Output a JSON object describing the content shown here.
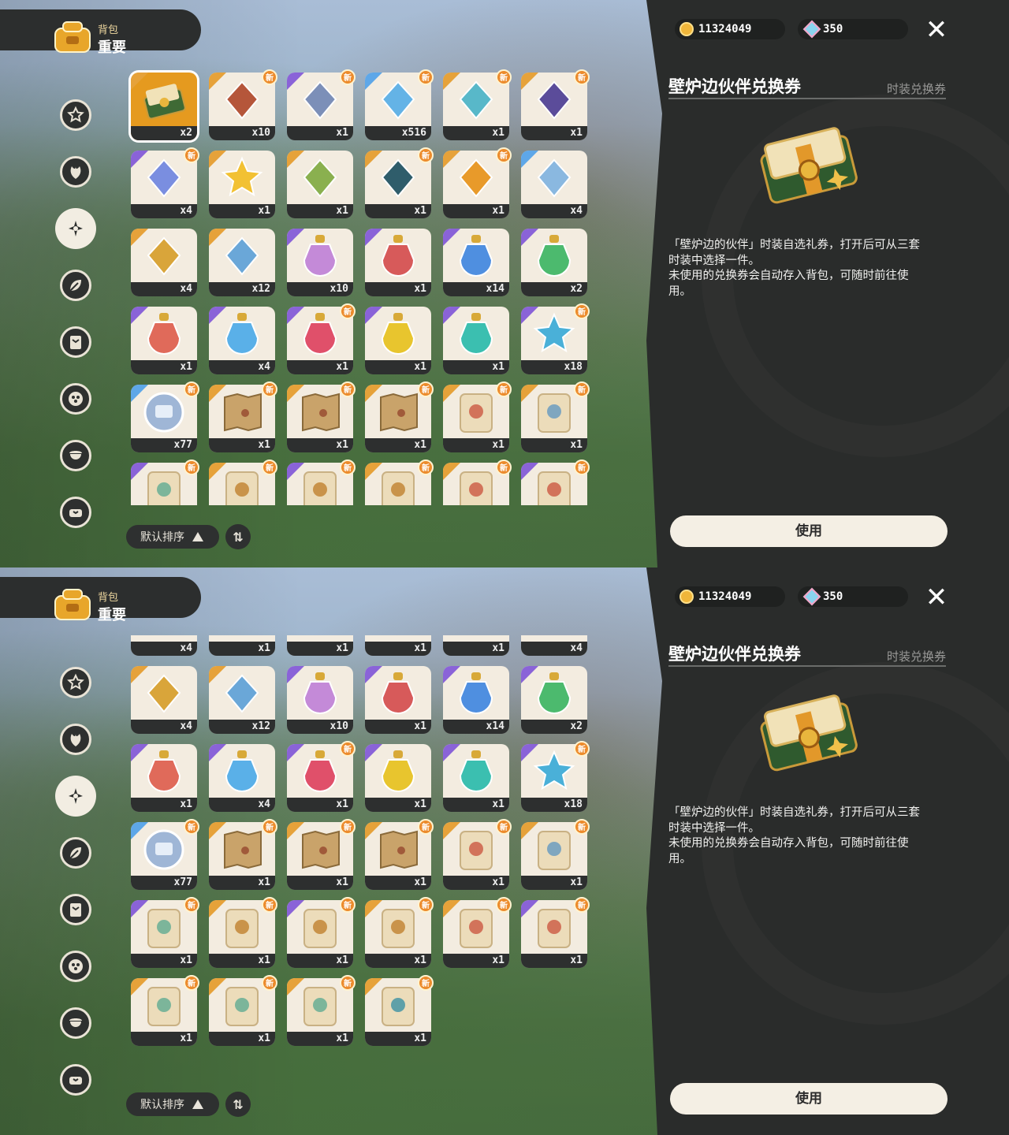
{
  "header": {
    "subtitle": "背包",
    "title": "重要"
  },
  "currency": {
    "coins": "11324049",
    "gems": "350"
  },
  "detail": {
    "name": "壁炉边伙伴兑换券",
    "type": "时装兑换券",
    "description": "「壁炉边的伙伴」时装自选礼券，打开后可从三套\n时装中选择一件。\n未使用的兑换券会自动存入背包，可随时前往使\n用。",
    "use_label": "使用"
  },
  "sort": {
    "label": "默认排序",
    "toggle_symbol": "⇅"
  },
  "new_badge": "新",
  "items": [
    {
      "icon": "coupon-icon",
      "qty": "x2",
      "rarity": "orange",
      "new": false,
      "color": "#3f6a35",
      "selected": true
    },
    {
      "icon": "photo-card-icon",
      "qty": "x10",
      "rarity": "orange",
      "new": true,
      "color": "#b5563a"
    },
    {
      "icon": "ticket-icon",
      "qty": "x1",
      "rarity": "purple",
      "new": true,
      "color": "#7c8fb8"
    },
    {
      "icon": "prism-icon",
      "qty": "x516",
      "rarity": "blue",
      "new": true,
      "color": "#64b3e6"
    },
    {
      "icon": "bottle-icon",
      "qty": "x1",
      "rarity": "orange",
      "new": true,
      "color": "#58b8c9"
    },
    {
      "icon": "pouch-icon",
      "qty": "x1",
      "rarity": "orange",
      "new": true,
      "color": "#5b4c9a"
    },
    {
      "icon": "crystal-icon",
      "qty": "x4",
      "rarity": "purple",
      "new": true,
      "color": "#7a8ee0"
    },
    {
      "icon": "star-icon",
      "qty": "x1",
      "rarity": "orange",
      "new": false,
      "color": "#f2c133"
    },
    {
      "icon": "crown-icon",
      "qty": "x1",
      "rarity": "orange",
      "new": false,
      "color": "#8ab04f"
    },
    {
      "icon": "shell-icon",
      "qty": "x1",
      "rarity": "orange",
      "new": true,
      "color": "#2f5d6b"
    },
    {
      "icon": "flower-icon",
      "qty": "x1",
      "rarity": "orange",
      "new": true,
      "color": "#e89a2a"
    },
    {
      "icon": "orb-icon",
      "qty": "x4",
      "rarity": "blue",
      "new": false,
      "color": "#8ab8e0"
    },
    {
      "icon": "key-icon",
      "qty": "x4",
      "rarity": "orange",
      "new": false,
      "color": "#d9a53a"
    },
    {
      "icon": "wand-icon",
      "qty": "x12",
      "rarity": "orange",
      "new": false,
      "color": "#6aa7d8"
    },
    {
      "icon": "potion-rainbow-icon",
      "qty": "x10",
      "rarity": "purple",
      "new": false,
      "color": "#c48ad8"
    },
    {
      "icon": "potion-red-icon",
      "qty": "x1",
      "rarity": "purple",
      "new": false,
      "color": "#d75a5a"
    },
    {
      "icon": "potion-blue-icon",
      "qty": "x14",
      "rarity": "purple",
      "new": false,
      "color": "#4f8fe0"
    },
    {
      "icon": "potion-green-icon",
      "qty": "x2",
      "rarity": "purple",
      "new": false,
      "color": "#4cba6e"
    },
    {
      "icon": "potion-red-icon",
      "qty": "x1",
      "rarity": "purple",
      "new": false,
      "color": "#e06a5a"
    },
    {
      "icon": "potion-blue-icon",
      "qty": "x4",
      "rarity": "purple",
      "new": false,
      "color": "#5ab0e8"
    },
    {
      "icon": "potion-pink-icon",
      "qty": "x1",
      "rarity": "purple",
      "new": true,
      "color": "#e0506a"
    },
    {
      "icon": "potion-yellow-icon",
      "qty": "x1",
      "rarity": "purple",
      "new": false,
      "color": "#e8c52e"
    },
    {
      "icon": "potion-teal-icon",
      "qty": "x1",
      "rarity": "purple",
      "new": false,
      "color": "#3bbfb0"
    },
    {
      "icon": "star-token-icon",
      "qty": "x18",
      "rarity": "purple",
      "new": true,
      "color": "#4ab0d8"
    },
    {
      "icon": "coin-token-icon",
      "qty": "x77",
      "rarity": "blue",
      "new": true,
      "color": "#9fb6d6"
    },
    {
      "icon": "map-icon",
      "qty": "x1",
      "rarity": "orange",
      "new": true,
      "color": "#c9a36a"
    },
    {
      "icon": "map-icon",
      "qty": "x1",
      "rarity": "orange",
      "new": true,
      "color": "#c9a36a"
    },
    {
      "icon": "map-icon",
      "qty": "x1",
      "rarity": "orange",
      "new": true,
      "color": "#c9a36a"
    },
    {
      "icon": "scroll-red-icon",
      "qty": "x1",
      "rarity": "orange",
      "new": true,
      "color": "#d2735a"
    },
    {
      "icon": "scroll-blue-icon",
      "qty": "x1",
      "rarity": "orange",
      "new": true,
      "color": "#7fa6bf"
    },
    {
      "icon": "scroll-green-icon",
      "qty": "x1",
      "rarity": "purple",
      "new": true,
      "color": "#7cb59a"
    },
    {
      "icon": "scroll-brown-icon",
      "qty": "x1",
      "rarity": "orange",
      "new": true,
      "color": "#c9934a"
    },
    {
      "icon": "scroll-brown-icon",
      "qty": "x1",
      "rarity": "purple",
      "new": true,
      "color": "#c9934a"
    },
    {
      "icon": "scroll-brown-icon",
      "qty": "x1",
      "rarity": "orange",
      "new": true,
      "color": "#c9934a"
    },
    {
      "icon": "scroll-red-icon",
      "qty": "x1",
      "rarity": "orange",
      "new": true,
      "color": "#d2735a"
    },
    {
      "icon": "scroll-red-icon",
      "qty": "x1",
      "rarity": "purple",
      "new": true,
      "color": "#d2735a"
    },
    {
      "icon": "scroll-green-icon",
      "qty": "x1",
      "rarity": "orange",
      "new": true,
      "color": "#7cb59a"
    },
    {
      "icon": "scroll-green-icon",
      "qty": "x1",
      "rarity": "orange",
      "new": true,
      "color": "#7cb59a"
    },
    {
      "icon": "scroll-green-icon",
      "qty": "x1",
      "rarity": "orange",
      "new": true,
      "color": "#7cb59a"
    },
    {
      "icon": "scroll-teal-icon",
      "qty": "x1",
      "rarity": "orange",
      "new": true,
      "color": "#5fa0a8"
    }
  ],
  "sidebar": [
    "star-badge-icon",
    "leaf-icon",
    "sparkle-icon",
    "feather-icon",
    "card-icon",
    "dots-icon",
    "acorn-icon",
    "sofa-icon"
  ]
}
